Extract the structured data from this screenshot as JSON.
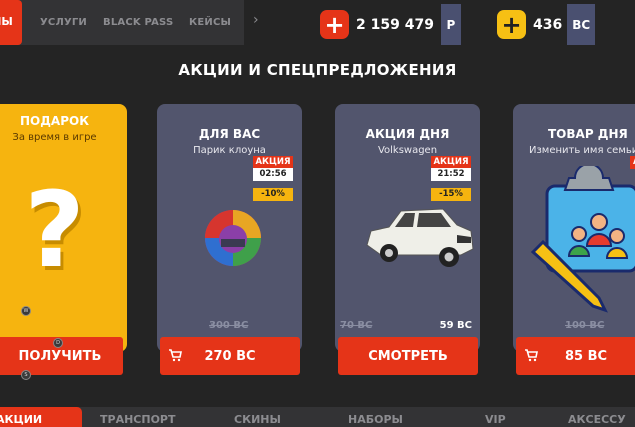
{
  "nav": {
    "active_partial": "ЫЫ",
    "tabs": [
      "УСЛУГИ",
      "BLACK PASS",
      "КЕЙСЫ"
    ],
    "more": "›"
  },
  "currencies": {
    "rub": {
      "icon": "plus-icon",
      "value": "2 159 479",
      "unit": "Р",
      "color": "#e53418"
    },
    "bc": {
      "icon": "plus-icon",
      "value": "436",
      "unit": "BC",
      "color": "#f6c014"
    }
  },
  "heading": "АКЦИИ И СПЕЦПРЕДЛОЖЕНИЯ",
  "cards": {
    "gift": {
      "title": "ПОДАРОК",
      "subtitle": "За время в игре",
      "button": "ПОЛУЧИТЬ",
      "mark": "?"
    },
    "for_you": {
      "title": "ДЛЯ ВАС",
      "subtitle": "Парик клоуна",
      "badge": "АКЦИЯ",
      "timer": "02:56",
      "discount": "-10%",
      "old_price": "300 BC",
      "price": "270 BC"
    },
    "deal": {
      "title": "АКЦИЯ ДНЯ",
      "subtitle": "Volkswagen",
      "badge": "АКЦИЯ",
      "timer": "21:52",
      "discount": "-15%",
      "old_price": "70 BC",
      "price": "59 BC",
      "button": "СМОТРЕТЬ"
    },
    "product": {
      "title": "ТОВАР ДНЯ",
      "subtitle": "Изменить имя семьи",
      "badge": "А",
      "old_price": "100 BC",
      "price": "85 BC"
    }
  },
  "debug_dots": [
    "W",
    "D",
    "S"
  ],
  "bottom_tabs": [
    "АКЦИИ",
    "ТРАНСПОРТ",
    "СКИНЫ",
    "НАБОРЫ",
    "VIP",
    "АКСЕССУ"
  ]
}
